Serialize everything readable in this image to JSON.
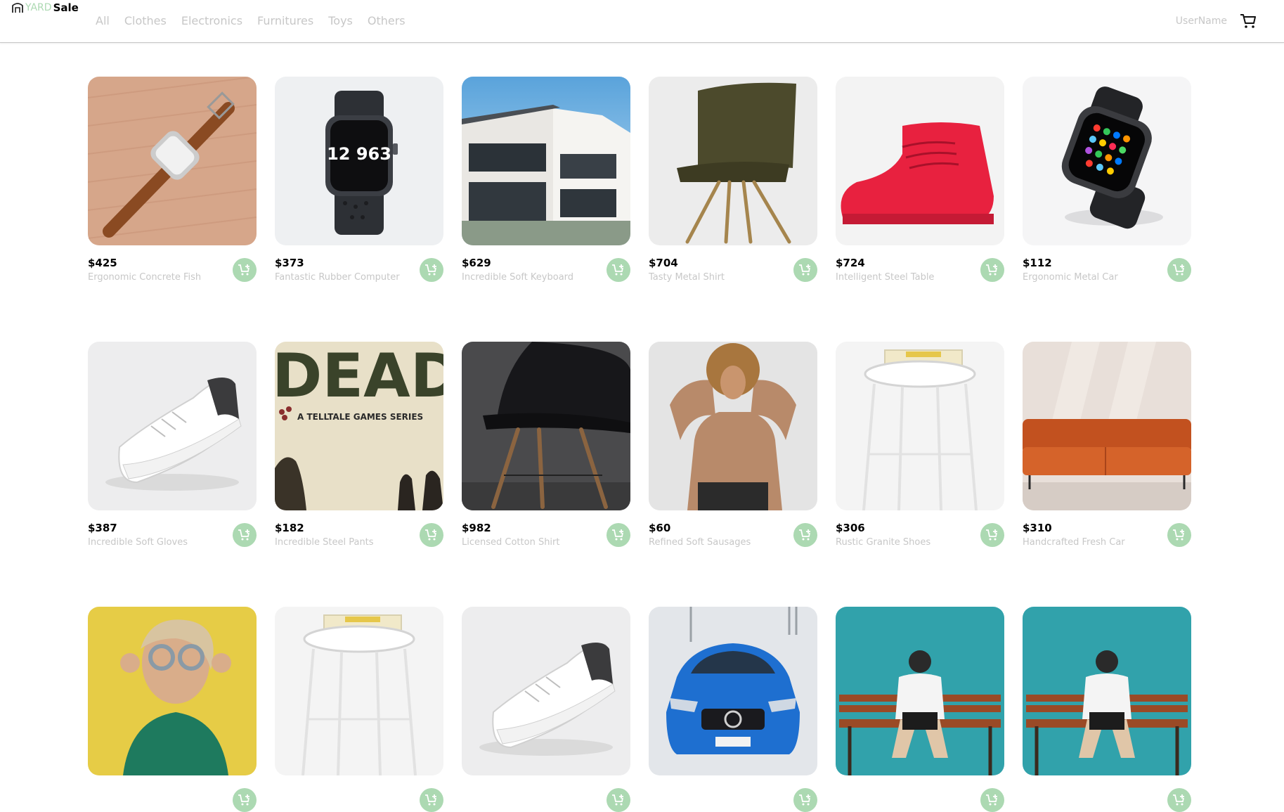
{
  "brand": {
    "prefix": "YARD",
    "name": "Sale",
    "accent": "#acd9b2"
  },
  "nav": {
    "categories": [
      "All",
      "Clothes",
      "Electronics",
      "Furnitures",
      "Toys",
      "Others"
    ],
    "username": "UserName",
    "cart_icon": "shopping-cart-icon"
  },
  "products": [
    {
      "price": "$425",
      "name": "Ergonomic Concrete Fish",
      "image": "smartwatch-brown-strap-on-wood"
    },
    {
      "price": "$373",
      "name": "Fantastic Rubber Computer",
      "image": "smartwatch-nike-dark"
    },
    {
      "price": "$629",
      "name": "Incredible Soft Keyboard",
      "image": "modern-house"
    },
    {
      "price": "$704",
      "name": "Tasty Metal Shirt",
      "image": "green-velvet-chair"
    },
    {
      "price": "$724",
      "name": "Intelligent Steel Table",
      "image": "red-sneaker"
    },
    {
      "price": "$112",
      "name": "Ergonomic Metal Car",
      "image": "smartwatch-black"
    },
    {
      "price": "$387",
      "name": "Incredible Soft Gloves",
      "image": "white-sneaker"
    },
    {
      "price": "$182",
      "name": "Incredible Steel Pants",
      "image": "game-cover"
    },
    {
      "price": "$982",
      "name": "Licensed Cotton Shirt",
      "image": "black-chair"
    },
    {
      "price": "$60",
      "name": "Refined Soft Sausages",
      "image": "woman-brown-sweater"
    },
    {
      "price": "$306",
      "name": "Rustic Granite Shoes",
      "image": "white-stool"
    },
    {
      "price": "$310",
      "name": "Handcrafted Fresh Car",
      "image": "orange-sofa"
    },
    {
      "price": "",
      "name": "",
      "image": "woman-yellow-wall"
    },
    {
      "price": "",
      "name": "",
      "image": "white-stool"
    },
    {
      "price": "",
      "name": "",
      "image": "white-sneaker"
    },
    {
      "price": "",
      "name": "",
      "image": "blue-car"
    },
    {
      "price": "",
      "name": "",
      "image": "person-on-bench"
    },
    {
      "price": "",
      "name": "",
      "image": "person-on-bench"
    }
  ],
  "game_cover_text": {
    "headline": "DEAD",
    "subtitle": "A TELLTALE GAMES SERIES"
  },
  "watch_face_text": "12 963",
  "add_button_icon": "add-to-cart-icon"
}
